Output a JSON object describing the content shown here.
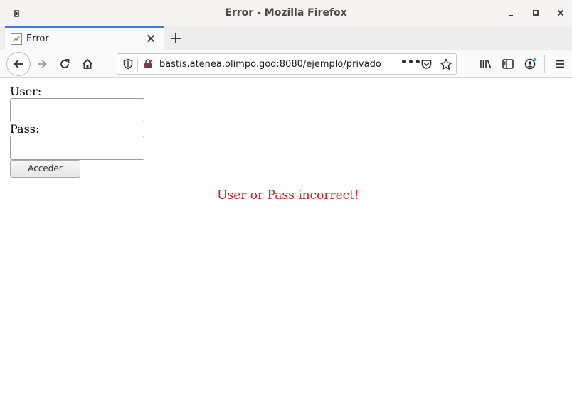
{
  "window": {
    "title": "Error - Mozilla Firefox"
  },
  "tab": {
    "title": "Error"
  },
  "navigation": {
    "url": "bastis.atenea.olimpo.god:8080/ejemplo/privado",
    "page_actions_label": "•••"
  },
  "login_form": {
    "user_label": "User:",
    "user_value": "",
    "pass_label": "Pass:",
    "pass_value": "",
    "submit_label": "Acceder"
  },
  "message": {
    "error_text": "User or Pass incorrect!",
    "error_color": "#d42020"
  },
  "colors": {
    "accent_tab": "#3d7cd1",
    "sync_dot": "#3aa7e0"
  }
}
